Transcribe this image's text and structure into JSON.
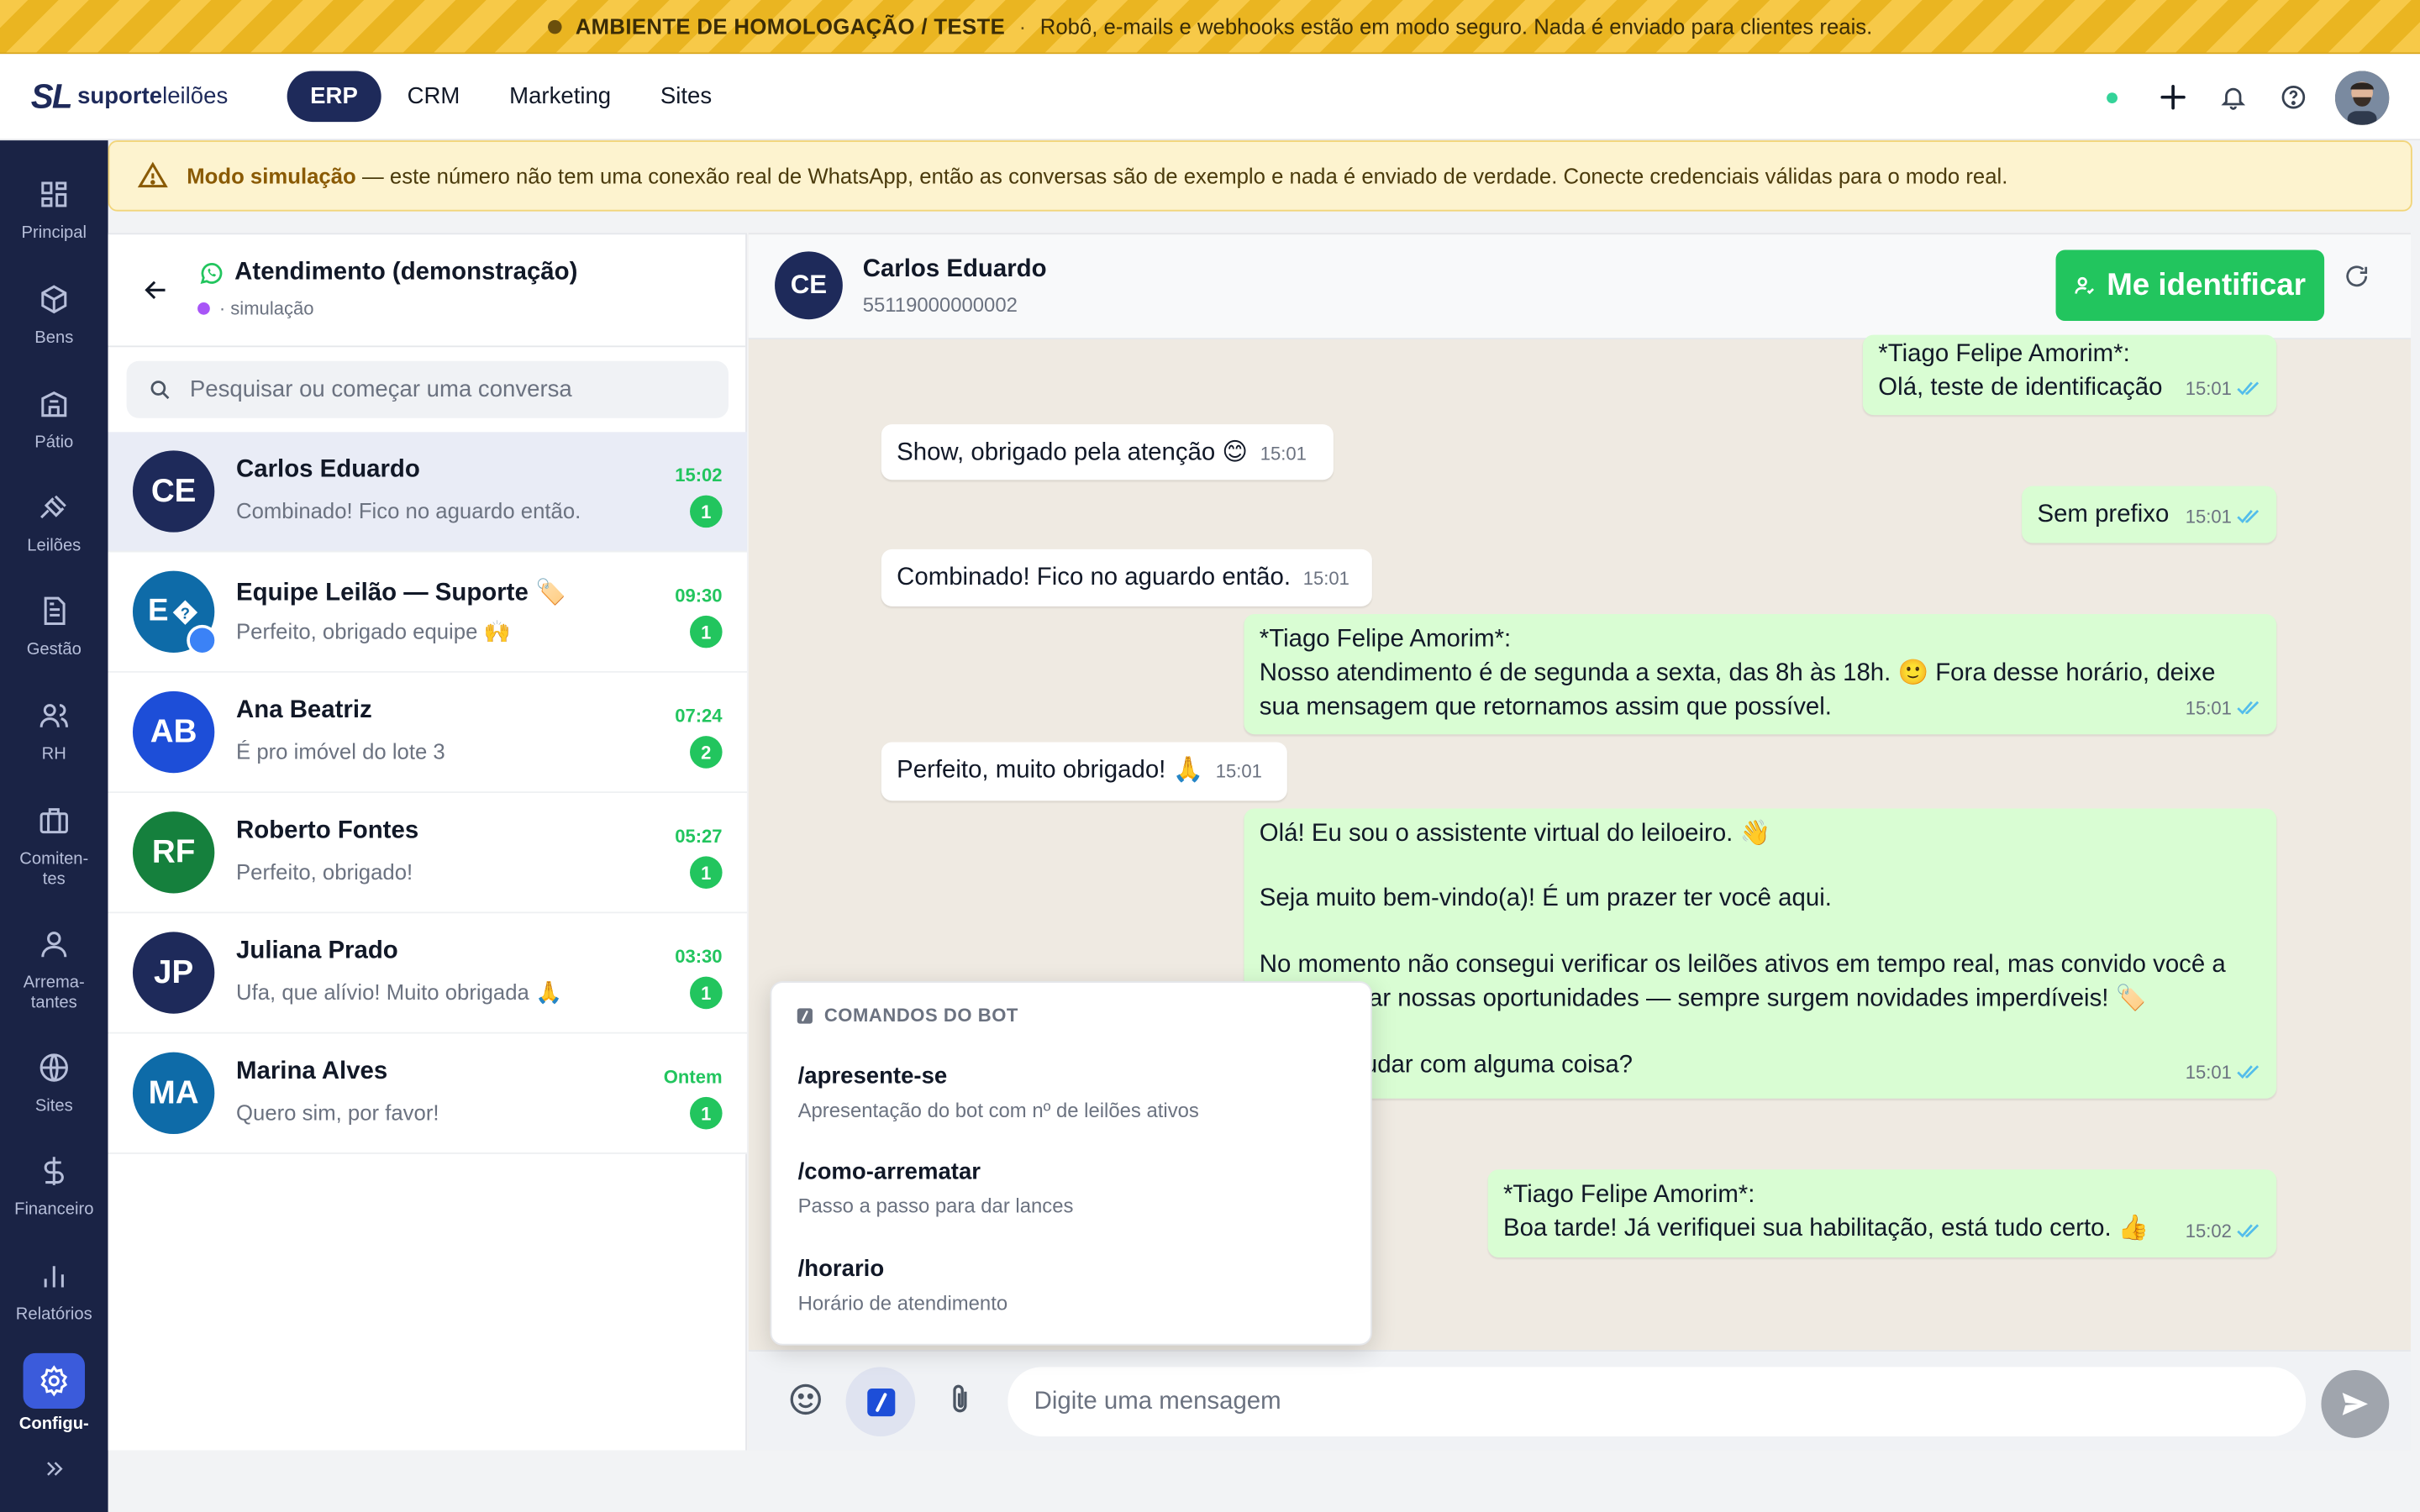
{
  "banner": {
    "label": "AMBIENTE DE HOMOLOGAÇÃO / TESTE",
    "sep": "·",
    "text": "Robô, e-mails e webhooks estão em modo seguro. Nada é enviado para clientes reais."
  },
  "brand": {
    "mark": "SL",
    "name_bold": "suporte",
    "name_light": "leilões"
  },
  "nav": {
    "tabs": [
      "ERP",
      "CRM",
      "Marketing",
      "Sites"
    ],
    "active": "ERP"
  },
  "sidebar": {
    "items": [
      "Principal",
      "Bens",
      "Pátio",
      "Leilões",
      "Gestão",
      "RH",
      "Comiten-\ntes",
      "Arrema-\ntantes",
      "Sites",
      "Financeiro",
      "Relatórios",
      "Configu-"
    ],
    "active": "Configu-"
  },
  "warning": {
    "bold": "Modo simulação",
    "text": "— este número não tem uma conexão real de WhatsApp, então as conversas são de exemplo e nada é enviado de verdade. Conecte credenciais válidas para o modo real."
  },
  "inbox": {
    "title": "Atendimento (demonstração)",
    "subtitle": "· simulação",
    "search_placeholder": "Pesquisar ou começar uma conversa",
    "conversations": [
      {
        "initials": "CE",
        "name": "Carlos Eduardo",
        "preview": "Combinado! Fico no aguardo então.",
        "time": "15:02",
        "unread": "1",
        "color": "#1e2a5a"
      },
      {
        "initials": "E",
        "name": "Equipe Leilão — Suporte 🏷️",
        "preview": "Perfeito, obrigado equipe 🙌",
        "time": "09:30",
        "unread": "1",
        "color": "#0e6ba8"
      },
      {
        "initials": "AB",
        "name": "Ana Beatriz",
        "preview": "É pro imóvel do lote 3",
        "time": "07:24",
        "unread": "2",
        "color": "#1d4ed8"
      },
      {
        "initials": "RF",
        "name": "Roberto Fontes",
        "preview": "Perfeito, obrigado!",
        "time": "05:27",
        "unread": "1",
        "color": "#15803d"
      },
      {
        "initials": "JP",
        "name": "Juliana Prado",
        "preview": "Ufa, que alívio! Muito obrigada 🙏",
        "time": "03:30",
        "unread": "1",
        "color": "#1e2a5a"
      },
      {
        "initials": "MA",
        "name": "Marina Alves",
        "preview": "Quero sim, por favor!",
        "time": "Ontem",
        "unread": "1",
        "color": "#0e6ba8"
      }
    ]
  },
  "chat": {
    "contact": {
      "initials": "CE",
      "name": "Carlos Eduardo",
      "phone": "55119000000002"
    },
    "identify_label": "Me identificar",
    "messages": [
      {
        "dir": "out",
        "lines": [
          "*Tiago Felipe Amorim*:",
          "Olá, teste de identificação"
        ],
        "time": "15:01"
      },
      {
        "dir": "in",
        "lines": [
          "Show, obrigado pela atenção 😊"
        ],
        "time": "15:01"
      },
      {
        "dir": "out",
        "lines": [
          "Sem prefixo"
        ],
        "time": "15:01"
      },
      {
        "dir": "in",
        "lines": [
          "Combinado! Fico no aguardo então."
        ],
        "time": "15:01"
      },
      {
        "dir": "out",
        "lines": [
          "*Tiago Felipe Amorim*:",
          "Nosso atendimento é de segunda a sexta, das 8h às 18h. 🙂  Fora desse horário, deixe",
          "sua mensagem que retornamos assim que possível."
        ],
        "time": "15:01"
      },
      {
        "dir": "in",
        "lines": [
          "Perfeito, muito obrigado! 🙏"
        ],
        "time": "15:01"
      },
      {
        "dir": "out",
        "lines": [
          "Olá! Eu sou o assistente virtual do leiloeiro. 👋",
          "Seja muito bem-vindo(a)! É um prazer ter você aqui.",
          "No momento não consegui verificar os leilões ativos em tempo real, mas convido você a",
          "nar nossas oportunidades — sempre surgem novidades imperdíveis! 🏷️",
          "judar com alguma coisa?"
        ],
        "time": "15:01"
      },
      {
        "dir": "out",
        "lines": [
          "*Tiago Felipe Amorim*:",
          "Boa tarde! Já verifiquei sua habilitação, está tudo certo. 👍"
        ],
        "time": "15:02"
      }
    ],
    "composer_placeholder": "Digite uma mensagem"
  },
  "bot_commands": {
    "title": "COMANDOS DO BOT",
    "items": [
      {
        "cmd": "/apresente-se",
        "desc": "Apresentação do bot com nº de leilões ativos"
      },
      {
        "cmd": "/como-arrematar",
        "desc": "Passo a passo para dar lances"
      },
      {
        "cmd": "/horario",
        "desc": "Horário de atendimento"
      }
    ]
  },
  "colors": {
    "navy": "#1e2a5a",
    "whatsapp_green": "#22c55e",
    "outgoing_bubble": "#d9fdd3",
    "chat_bg": "#efeae2",
    "accent_blue": "#3b5bdb"
  },
  "icons": [
    "grid-icon",
    "box-icon",
    "building-icon",
    "gavel-icon",
    "document-icon",
    "users-icon",
    "briefcase-icon",
    "user-icon",
    "globe-icon",
    "dollar-icon",
    "bar-chart-icon",
    "gear-icon",
    "chevrons-right-icon",
    "plus-icon",
    "bell-icon",
    "help-icon",
    "warning-triangle-icon",
    "back-arrow-icon",
    "whatsapp-icon",
    "search-icon",
    "user-check-icon",
    "refresh-icon",
    "emoji-icon",
    "slash-command-icon",
    "paperclip-icon",
    "send-icon",
    "double-check-icon"
  ]
}
